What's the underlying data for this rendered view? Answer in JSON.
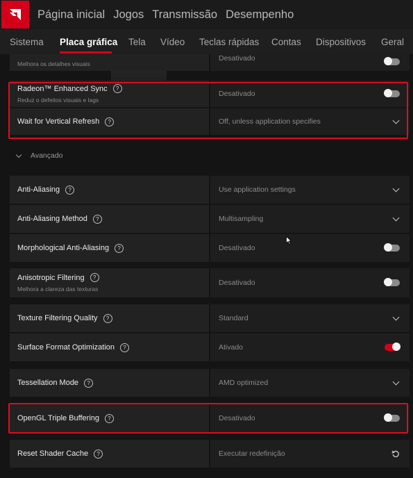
{
  "colors": {
    "accent": "#d4001a",
    "highlight": "#e10b1c"
  },
  "topnav": {
    "logo_icon": "amd-logo-icon",
    "items": [
      "Página inicial",
      "Jogos",
      "Transmissão",
      "Desempenho"
    ]
  },
  "subnav": {
    "items": [
      "Sistema",
      "Placa gráfica",
      "Tela",
      "Vídeo",
      "Teclas rápidas",
      "Contas",
      "Dispositivos",
      "Geral"
    ],
    "active": "Placa gráfica"
  },
  "rows": [
    {
      "label": "",
      "sub": "Melhora os detalhes visuais",
      "value": "Desativado",
      "control": "toggle",
      "on": false
    },
    {
      "label": "Radeon™ Enhanced Sync",
      "sub": "Reduz o defeitos visuais e lags",
      "value": "Desativado",
      "control": "toggle",
      "on": false
    },
    {
      "label": "Wait for Vertical Refresh",
      "sub": "",
      "value": "Off, unless application specifies",
      "control": "dropdown"
    },
    {
      "label": "Anti-Aliasing",
      "sub": "",
      "value": "Use application settings",
      "control": "dropdown"
    },
    {
      "label": "Anti-Aliasing Method",
      "sub": "",
      "value": "Multisampling",
      "control": "dropdown"
    },
    {
      "label": "Morphological Anti-Aliasing",
      "sub": "",
      "value": "Desativado",
      "control": "toggle",
      "on": false
    },
    {
      "label": "Anisotropic Filtering",
      "sub": "Melhora a clareza das texturas",
      "value": "Desativado",
      "control": "toggle",
      "on": false
    },
    {
      "label": "Texture Filtering Quality",
      "sub": "",
      "value": "Standard",
      "control": "dropdown"
    },
    {
      "label": "Surface Format Optimization",
      "sub": "",
      "value": "Ativado",
      "control": "toggle",
      "on": true
    },
    {
      "label": "Tessellation Mode",
      "sub": "",
      "value": "AMD optimized",
      "control": "dropdown"
    },
    {
      "label": "OpenGL Triple Buffering",
      "sub": "",
      "value": "Desativado",
      "control": "toggle",
      "on": false
    },
    {
      "label": "Reset Shader Cache",
      "sub": "",
      "value": "Executar redefinição",
      "control": "reset"
    }
  ],
  "section": {
    "label": "Avançado",
    "icon": "chevron-down-icon"
  },
  "help_glyph": "?"
}
